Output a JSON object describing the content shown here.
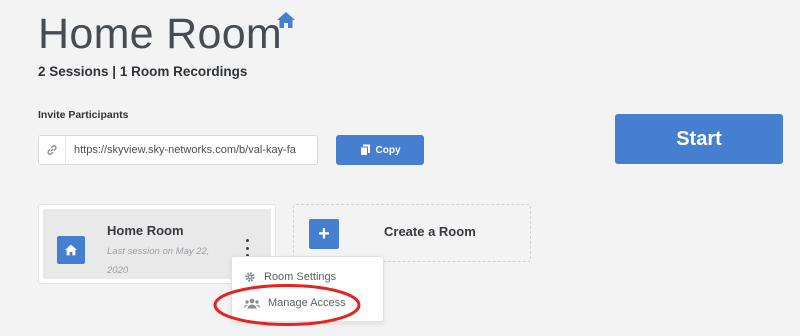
{
  "header": {
    "title": "Home Room",
    "stats": "2 Sessions | 1 Room Recordings"
  },
  "invite": {
    "label": "Invite Participants",
    "url": "https://skyview.sky-networks.com/b/val-kay-fa",
    "copy_label": "Copy"
  },
  "start_label": "Start",
  "room_card": {
    "name": "Home Room",
    "last_session": "Last session on May 22, 2020"
  },
  "create_room": {
    "label": "Create a Room"
  },
  "dropdown": {
    "items": [
      {
        "label": "Room Settings",
        "icon": "gear-icon"
      },
      {
        "label": "Manage Access",
        "icon": "users-icon"
      }
    ]
  },
  "colors": {
    "primary": "#467fcf",
    "background": "#f3f3f3",
    "annotation_red": "#e8231f"
  }
}
